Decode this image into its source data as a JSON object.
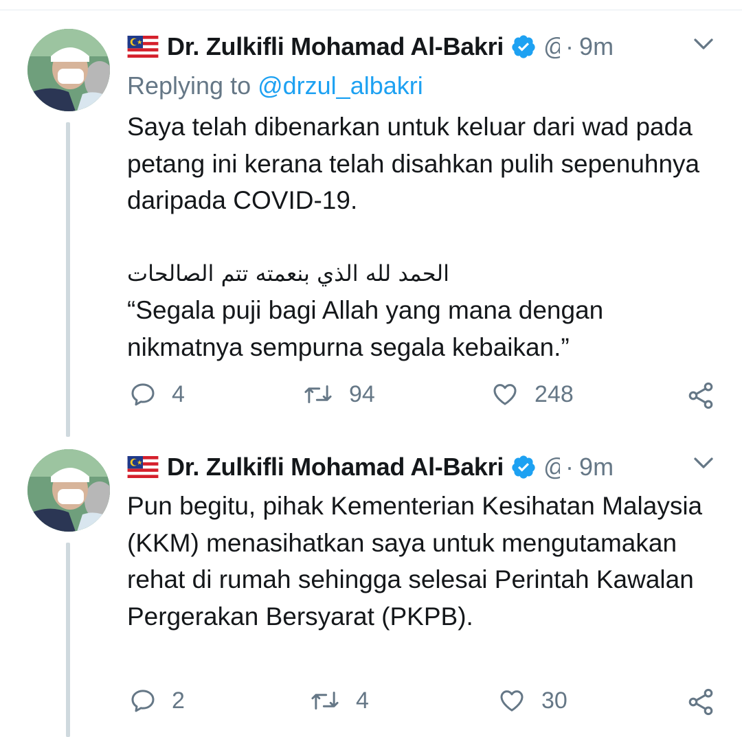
{
  "tweets": [
    {
      "author": {
        "name": "Dr. Zulkifli Mohamad Al-Bakri",
        "handle_truncated": "@",
        "flag_icon": "malaysia-flag-icon",
        "verified_icon": "verified-badge-icon"
      },
      "separator": "·",
      "time": "9m",
      "replying_label": "Replying to ",
      "replying_handle": "@drzul_albakri",
      "paragraphs": [
        "Saya telah dibenarkan untuk keluar dari wad pada petang ini kerana telah disahkan pulih sepenuhnya daripada COVID-19.",
        "الحمد لله الذي بنعمته تتم الصالحات",
        "“Segala puji bagi Allah yang mana dengan nikmatnya sempurna segala kebaikan.”"
      ],
      "stats": {
        "replies": "4",
        "retweets": "94",
        "likes": "248"
      }
    },
    {
      "author": {
        "name": "Dr. Zulkifli Mohamad Al-Bakri",
        "handle_truncated": "@",
        "flag_icon": "malaysia-flag-icon",
        "verified_icon": "verified-badge-icon"
      },
      "separator": "·",
      "time": "9m",
      "paragraphs": [
        "Pun begitu, pihak Kementerian Kesihatan Malaysia (KKM) menasihatkan saya untuk mengutamakan rehat di rumah sehingga selesai Perintah Kawalan Pergerakan Bersyarat (PKPB)."
      ],
      "stats": {
        "replies": "2",
        "retweets": "4",
        "likes": "30"
      }
    }
  ],
  "colors": {
    "text": "#14171a",
    "secondary": "#657786",
    "link": "#1da1f2",
    "verified": "#1da1f2",
    "thread_line": "#cfd9de"
  }
}
